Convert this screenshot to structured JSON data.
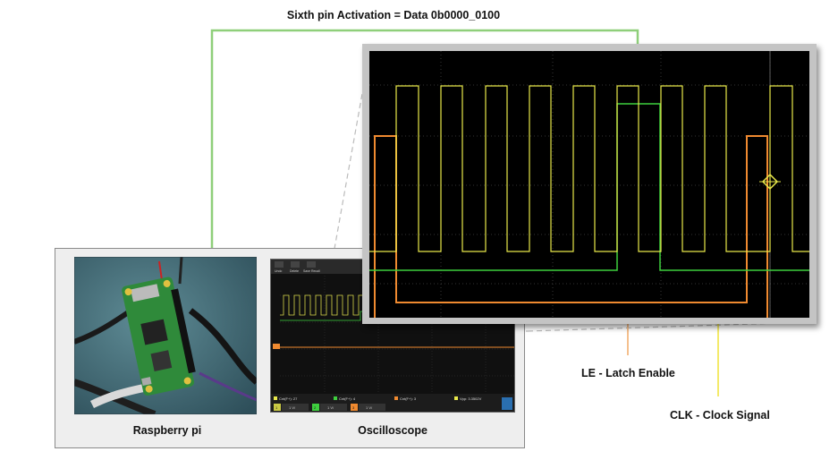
{
  "title": "Sixth pin Activation = Data 0b0000_0100",
  "labels": {
    "raspberry_pi": "Raspberry pi",
    "oscilloscope": "Oscilloscope",
    "latch_enable": "LE - Latch Enable",
    "clock_signal": "CLK - Clock Signal"
  },
  "oscilloscope_ui": {
    "toolbar": [
      "Undo",
      "Delete",
      "Save Recall"
    ],
    "channel_readouts": [
      "Cnt(F+): 27",
      "Cnt(F+): 4",
      "Cnt(F+): 3",
      "Vpp: 3.3502V"
    ],
    "channel_scales": [
      "1",
      "1 V/",
      "2",
      "1 V/",
      "3",
      "1 V/"
    ]
  },
  "colors": {
    "clk_trace": "#e8e84a",
    "data_trace": "#3ecf3e",
    "le_trace": "#f08a30",
    "title_connector": "#8fcf7a",
    "le_pointer": "#f5c08e",
    "clk_pointer": "#f0e43a",
    "grid": "#444444"
  }
}
